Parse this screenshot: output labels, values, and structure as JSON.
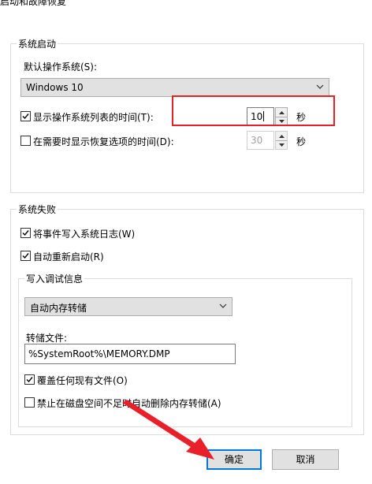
{
  "window": {
    "title": "启动和故障恢复"
  },
  "startup": {
    "group_label": "系统启动",
    "default_os_label": "默认操作系统(S):",
    "default_os_value": "Windows 10",
    "show_list_label": "显示操作系统列表的时间(T):",
    "show_list_checked": true,
    "show_list_value": "10",
    "show_list_unit": "秒",
    "show_recovery_label": "在需要时显示恢复选项的时间(D):",
    "show_recovery_checked": false,
    "show_recovery_value": "30",
    "show_recovery_unit": "秒"
  },
  "failure": {
    "group_label": "系统失败",
    "write_event_label": "将事件写入系统日志(W)",
    "write_event_checked": true,
    "auto_restart_label": "自动重新启动(R)",
    "auto_restart_checked": true,
    "debug_info": {
      "group_label": "写入调试信息",
      "dump_type_value": "自动内存转储",
      "dump_file_label": "转储文件:",
      "dump_file_value": "%SystemRoot%\\MEMORY.DMP",
      "overwrite_label": "覆盖任何现有文件(O)",
      "overwrite_checked": true,
      "disable_auto_delete_label": "禁止在磁盘空间不足时自动删除内存转储(A)",
      "disable_auto_delete_checked": false
    }
  },
  "buttons": {
    "ok_label": "确定",
    "cancel_label": "取消"
  },
  "colors": {
    "highlight": "#e8202a",
    "arrow": "#e8202a",
    "accent": "#0078d7"
  }
}
